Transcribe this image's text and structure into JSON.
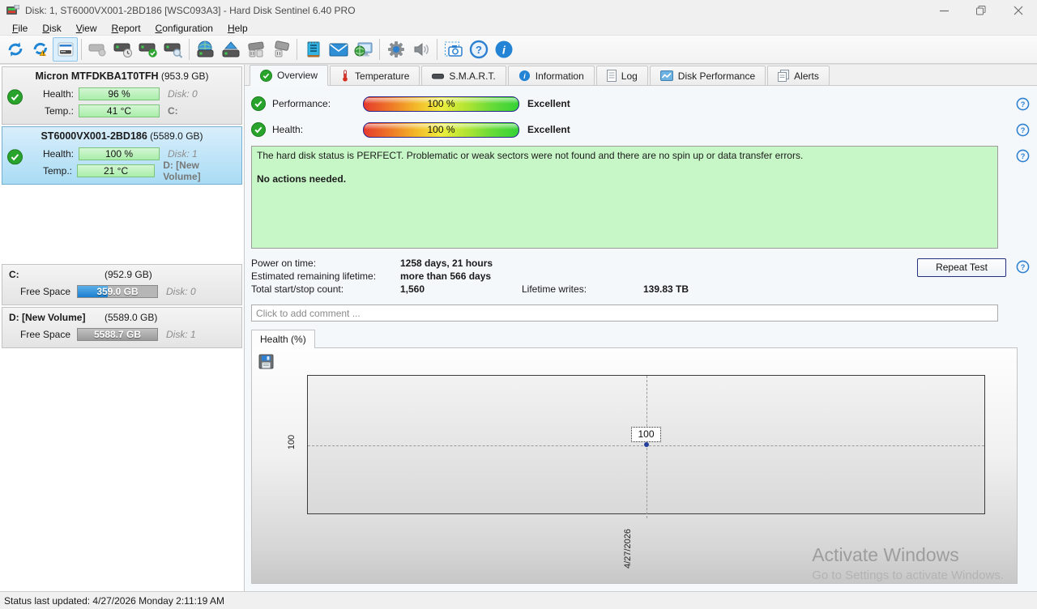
{
  "window": {
    "title": "Disk: 1, ST6000VX001-2BD186 [WSC093A3]  -  Hard Disk Sentinel 6.40 PRO"
  },
  "menu": {
    "items": [
      "File",
      "Disk",
      "View",
      "Report",
      "Configuration",
      "Help"
    ]
  },
  "toolbar": {
    "icons": [
      "refresh-icon",
      "refresh-warning-icon",
      "disk-panel-toggle-icon",
      "disk-offline-icon",
      "disk-clock-icon",
      "disk-accept-icon",
      "disk-search-icon",
      "disk-network-icon",
      "disk-eject-icon",
      "disk-unplug-icon",
      "disk-plug-icon",
      "report-notepad-icon",
      "mail-icon",
      "network-monitor-icon",
      "settings-gear-icon",
      "sound-icon",
      "screenshot-camera-icon",
      "help-icon",
      "info-icon"
    ]
  },
  "sidebar": {
    "disks": [
      {
        "name": "Micron MTFDKBA1T0TFH",
        "size": "(953.9 GB)",
        "health_label": "Health:",
        "health": "96 %",
        "temp_label": "Temp.:",
        "temp": "41 °C",
        "disk_ref": "Disk: 0",
        "volume_ref": "C:"
      },
      {
        "name": "ST6000VX001-2BD186",
        "size": "(5589.0 GB)",
        "health_label": "Health:",
        "health": "100 %",
        "temp_label": "Temp.:",
        "temp": "21 °C",
        "disk_ref": "Disk: 1",
        "volume_ref": "D: [New Volume]"
      }
    ],
    "volumes": [
      {
        "name": "C:",
        "size": "(952.9 GB)",
        "free_label": "Free Space",
        "free": "359.0 GB",
        "disk_ref": "Disk: 0",
        "fill_pct": 38,
        "fill_style": "blue"
      },
      {
        "name": "D: [New Volume]",
        "size": "(5589.0 GB)",
        "free_label": "Free Space",
        "free": "5588.7 GB",
        "disk_ref": "Disk: 1",
        "fill_pct": 100,
        "fill_style": "gray"
      }
    ]
  },
  "tabs": [
    {
      "label": "Overview"
    },
    {
      "label": "Temperature"
    },
    {
      "label": "S.M.A.R.T."
    },
    {
      "label": "Information"
    },
    {
      "label": "Log"
    },
    {
      "label": "Disk Performance"
    },
    {
      "label": "Alerts"
    }
  ],
  "overview": {
    "metrics": [
      {
        "label": "Performance:",
        "value": "100 %",
        "rating": "Excellent"
      },
      {
        "label": "Health:",
        "value": "100 %",
        "rating": "Excellent"
      }
    ],
    "status_line1": "The hard disk status is PERFECT. Problematic or weak sectors were not found and there are no spin up or data transfer errors.",
    "status_line2": "No actions needed.",
    "stats": {
      "power_on_label": "Power on time:",
      "power_on_value": "1258 days, 21 hours",
      "lifetime_label": "Estimated remaining lifetime:",
      "lifetime_value": "more than 566 days",
      "startstop_label": "Total start/stop count:",
      "startstop_value": "1,560",
      "writes_label": "Lifetime writes:",
      "writes_value": "139.83 TB"
    },
    "repeat_test_label": "Repeat Test",
    "comment_placeholder": "Click to add comment ...",
    "chart_tab_label": "Health (%)"
  },
  "chart_data": {
    "type": "line",
    "title": "Health (%)",
    "x": [
      "4/27/2026"
    ],
    "series": [
      {
        "name": "Health %",
        "values": [
          100
        ]
      }
    ],
    "y_ticks": [
      "100"
    ],
    "point_labels": [
      "100"
    ],
    "ylim": [
      0,
      200
    ],
    "grid": "dashed",
    "legend": false
  },
  "watermark": {
    "line1": "Activate Windows",
    "line2": "Go to Settings to activate Windows."
  },
  "statusbar": {
    "text": "Status last updated: 4/27/2026 Monday 2:11:19 AM"
  }
}
